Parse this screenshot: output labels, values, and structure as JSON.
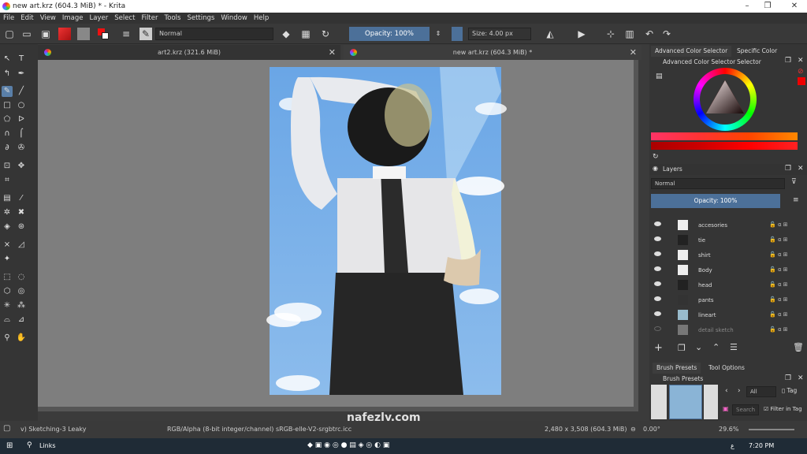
{
  "window": {
    "title": "new art.krz (604.3 MiB) * - Krita",
    "min": "–",
    "max": "❐",
    "close": "✕"
  },
  "menu": [
    "File",
    "Edit",
    "View",
    "Image",
    "Layer",
    "Select",
    "Filter",
    "Tools",
    "Settings",
    "Window",
    "Help"
  ],
  "toolbar": {
    "blend_mode": "Normal",
    "opacity": "Opacity: 100%",
    "size": "Size: 4.00 px"
  },
  "tabs": [
    {
      "title": "art2.krz (321.6 MiB)",
      "close": "✕"
    },
    {
      "title": "new art.krz (604.3 MiB) *",
      "close": "✕"
    }
  ],
  "docker": {
    "tabs": [
      "Advanced Color Selector",
      "Specific Color Selector"
    ],
    "color_title": "Advanced Color Selector",
    "layers_title": "Layers",
    "layers_mode": "Normal",
    "layers_opacity": "Opacity:  100%",
    "layers": [
      {
        "name": "accesories",
        "visible": true
      },
      {
        "name": "tie",
        "visible": true
      },
      {
        "name": "shirt",
        "visible": true
      },
      {
        "name": "Body",
        "visible": true
      },
      {
        "name": "head",
        "visible": true
      },
      {
        "name": "pants",
        "visible": true
      },
      {
        "name": "lineart",
        "visible": true
      },
      {
        "name": "detail sketch",
        "visible": false
      }
    ],
    "bottom_tabs": [
      "Brush Presets",
      "Tool Options"
    ],
    "brush_title": "Brush Presets",
    "brush_filter": "All",
    "brush_tag": "Tag",
    "search_placeholder": "Search",
    "filter_in_tag": "Filter in Tag"
  },
  "status": {
    "brush": "v) Sketching-3 Leaky",
    "color": "RGB/Alpha (8-bit integer/channel)  sRGB-elle-V2-srgbtrc.icc",
    "size": "2,480 x 3,508 (604.3 MiB)",
    "rotation": "0.00°",
    "zoom": "29.6%"
  },
  "taskbar": {
    "search": "Links",
    "time": "7:20 PM",
    "lang": "ع"
  },
  "watermark": "nafezly.com",
  "colors": {
    "accent": "#4c7099",
    "bg": "#353535",
    "sky": "#6aa6e6"
  }
}
